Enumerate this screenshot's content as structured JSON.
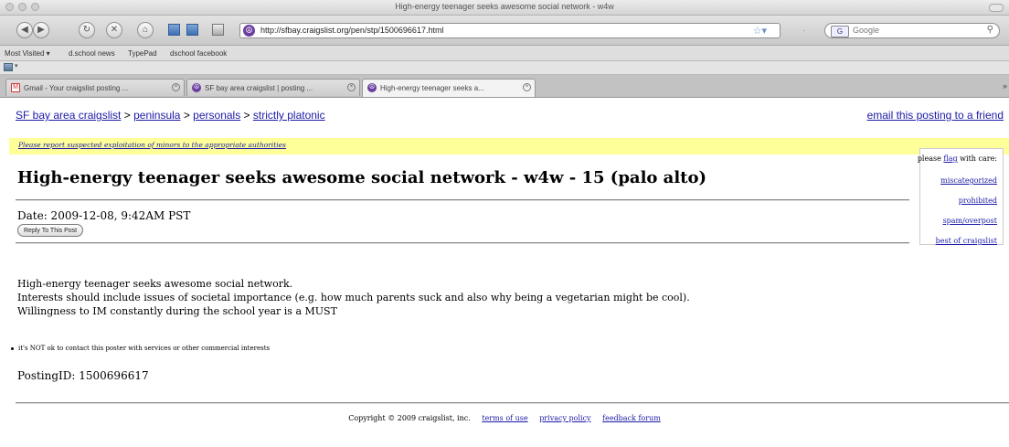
{
  "window": {
    "title": "High-energy teenager seeks awesome social network - w4w"
  },
  "nav": {
    "url": "http://sfbay.craigslist.org/pen/stp/1500696617.html",
    "search_placeholder": "Google",
    "search_engine_label": "G"
  },
  "bookmarks": [
    "Most Visited ▾",
    "d.school news",
    "TypePad",
    "dschool facebook"
  ],
  "tabs": [
    {
      "label": "Gmail - Your craigslist posting ...",
      "icon": "gmail-icon"
    },
    {
      "label": "SF bay area craigslist | posting ...",
      "icon": "peace-icon"
    },
    {
      "label": "High-energy teenager seeks a...",
      "icon": "peace-icon",
      "active": true
    }
  ],
  "page": {
    "breadcrumb": {
      "site": "SF bay area craigslist",
      "sep": ">",
      "area": "peninsula",
      "section": "personals",
      "category": "strictly platonic"
    },
    "email_link": "email this posting to a friend",
    "notice": "Please report suspected exploitation of minors to the appropriate authorities",
    "flag": {
      "prefix": "please",
      "flag_word": "flag",
      "suffix": "with care:",
      "options": [
        "miscategorized",
        "prohibited",
        "spam/overpost",
        "best of craigslist"
      ]
    },
    "title": "High-energy teenager seeks awesome social network - w4w - 15 (palo alto)",
    "date": "Date: 2009-12-08, 9:42AM PST",
    "reply_button": "Reply To This Post",
    "body_lines": [
      "High-energy teenager seeks awesome social network.",
      "Interests should include issues of societal importance (e.g. how much parents suck and also why being a vegetarian might be cool).",
      "Willingness to IM constantly during the school year is a MUST"
    ],
    "disclaimer": "it's NOT ok to contact this poster with services or other commercial interests",
    "posting_id": "PostingID: 1500696617",
    "footer": {
      "copyright": "Copyright © 2009 craigslist, inc.",
      "links": [
        "terms of use",
        "privacy policy",
        "feedback forum"
      ]
    }
  }
}
